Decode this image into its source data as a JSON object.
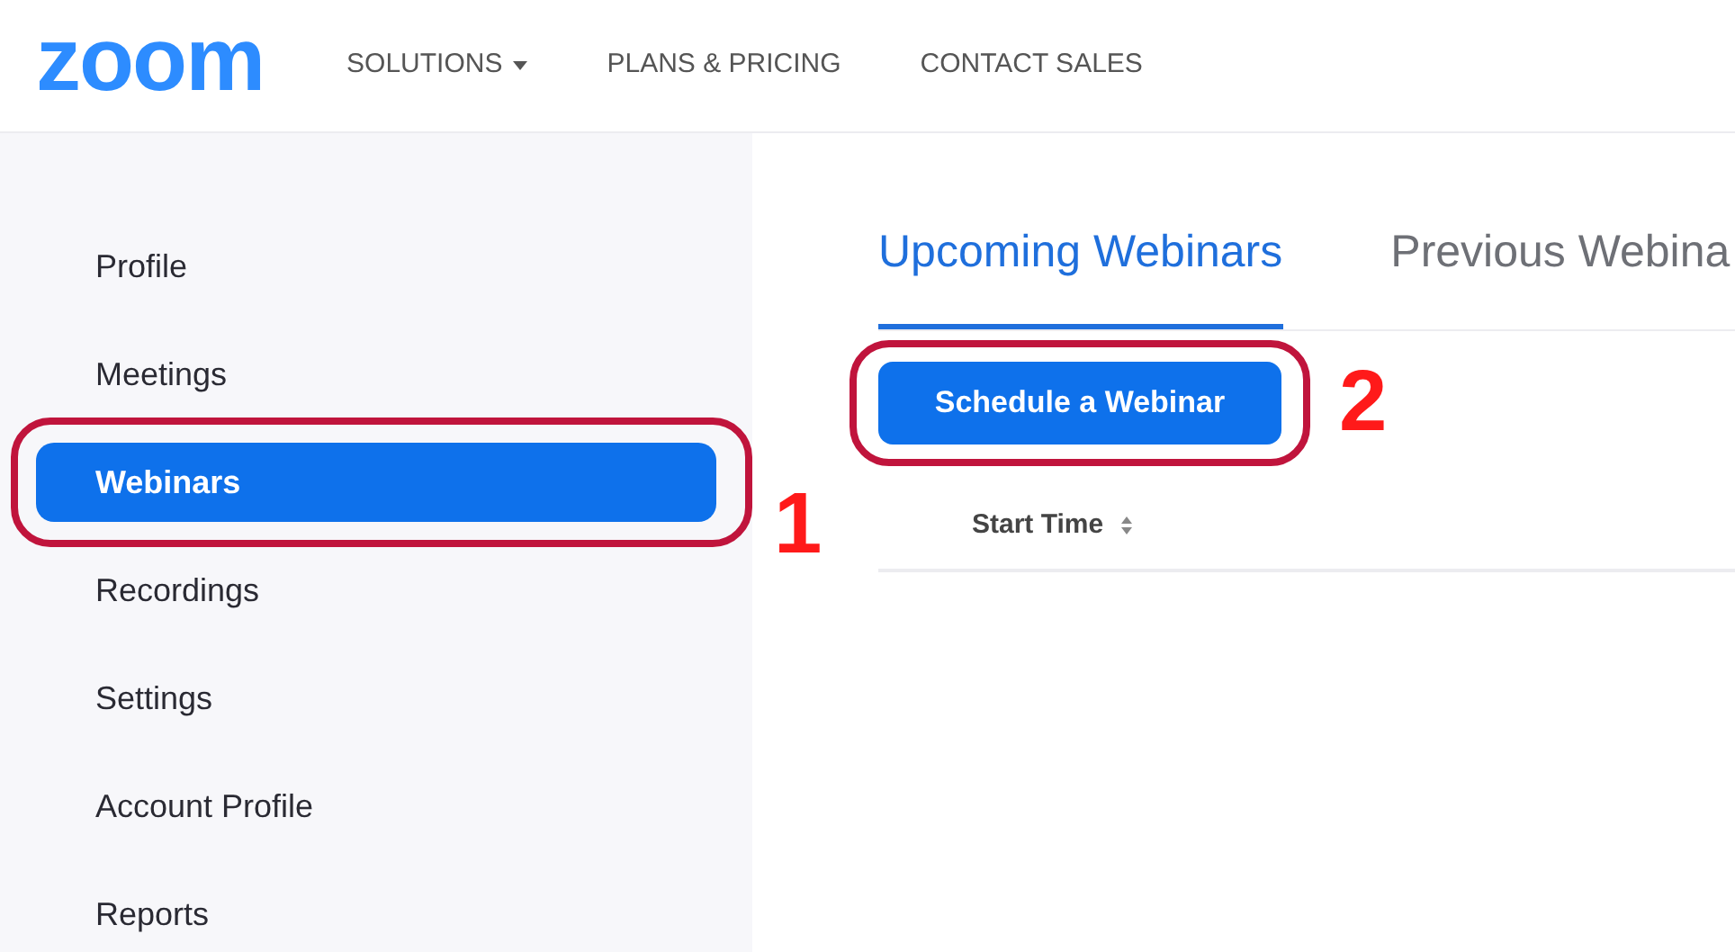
{
  "header": {
    "logo": "zoom",
    "nav": [
      {
        "label": "SOLUTIONS",
        "dropdown": true
      },
      {
        "label": "PLANS & PRICING",
        "dropdown": false
      },
      {
        "label": "CONTACT SALES",
        "dropdown": false
      }
    ]
  },
  "sidebar": {
    "items": [
      {
        "label": "Profile",
        "selected": false,
        "highlighted": false
      },
      {
        "label": "Meetings",
        "selected": false,
        "highlighted": false
      },
      {
        "label": "Webinars",
        "selected": true,
        "highlighted": true
      },
      {
        "label": "Recordings",
        "selected": false,
        "highlighted": false
      },
      {
        "label": "Settings",
        "selected": false,
        "highlighted": false
      },
      {
        "label": "Account Profile",
        "selected": false,
        "highlighted": false
      },
      {
        "label": "Reports",
        "selected": false,
        "highlighted": false
      }
    ]
  },
  "tabs": [
    {
      "label": "Upcoming Webinars",
      "selected": true
    },
    {
      "label": "Previous Webina",
      "selected": false
    }
  ],
  "schedule_button": {
    "label": "Schedule a Webinar",
    "highlighted": true
  },
  "table": {
    "columns": [
      {
        "label": "Start Time",
        "sortable": true
      }
    ]
  },
  "annotations": [
    "1",
    "2"
  ]
}
